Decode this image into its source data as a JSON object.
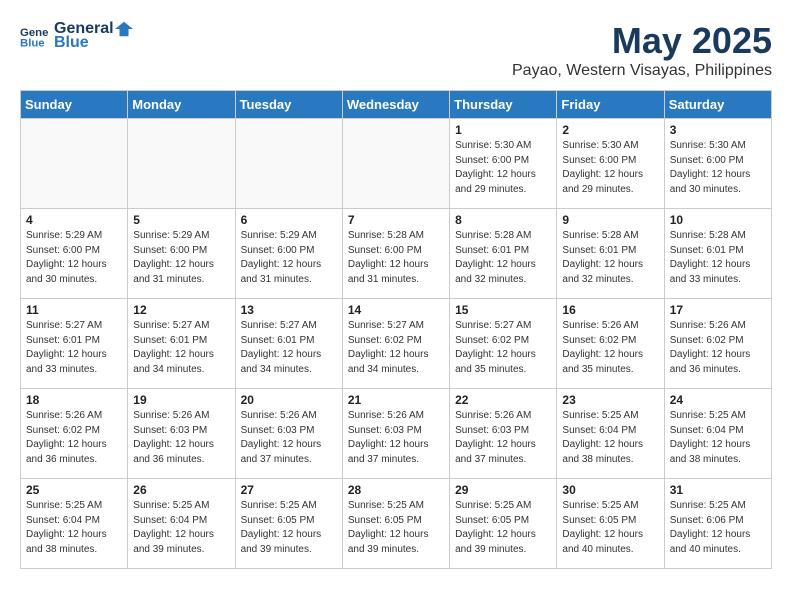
{
  "header": {
    "logo_line1": "General",
    "logo_line2": "Blue",
    "month_title": "May 2025",
    "location": "Payao, Western Visayas, Philippines"
  },
  "days_of_week": [
    "Sunday",
    "Monday",
    "Tuesday",
    "Wednesday",
    "Thursday",
    "Friday",
    "Saturday"
  ],
  "weeks": [
    [
      {
        "day": "",
        "info": ""
      },
      {
        "day": "",
        "info": ""
      },
      {
        "day": "",
        "info": ""
      },
      {
        "day": "",
        "info": ""
      },
      {
        "day": "1",
        "info": "Sunrise: 5:30 AM\nSunset: 6:00 PM\nDaylight: 12 hours\nand 29 minutes."
      },
      {
        "day": "2",
        "info": "Sunrise: 5:30 AM\nSunset: 6:00 PM\nDaylight: 12 hours\nand 29 minutes."
      },
      {
        "day": "3",
        "info": "Sunrise: 5:30 AM\nSunset: 6:00 PM\nDaylight: 12 hours\nand 30 minutes."
      }
    ],
    [
      {
        "day": "4",
        "info": "Sunrise: 5:29 AM\nSunset: 6:00 PM\nDaylight: 12 hours\nand 30 minutes."
      },
      {
        "day": "5",
        "info": "Sunrise: 5:29 AM\nSunset: 6:00 PM\nDaylight: 12 hours\nand 31 minutes."
      },
      {
        "day": "6",
        "info": "Sunrise: 5:29 AM\nSunset: 6:00 PM\nDaylight: 12 hours\nand 31 minutes."
      },
      {
        "day": "7",
        "info": "Sunrise: 5:28 AM\nSunset: 6:00 PM\nDaylight: 12 hours\nand 31 minutes."
      },
      {
        "day": "8",
        "info": "Sunrise: 5:28 AM\nSunset: 6:01 PM\nDaylight: 12 hours\nand 32 minutes."
      },
      {
        "day": "9",
        "info": "Sunrise: 5:28 AM\nSunset: 6:01 PM\nDaylight: 12 hours\nand 32 minutes."
      },
      {
        "day": "10",
        "info": "Sunrise: 5:28 AM\nSunset: 6:01 PM\nDaylight: 12 hours\nand 33 minutes."
      }
    ],
    [
      {
        "day": "11",
        "info": "Sunrise: 5:27 AM\nSunset: 6:01 PM\nDaylight: 12 hours\nand 33 minutes."
      },
      {
        "day": "12",
        "info": "Sunrise: 5:27 AM\nSunset: 6:01 PM\nDaylight: 12 hours\nand 34 minutes."
      },
      {
        "day": "13",
        "info": "Sunrise: 5:27 AM\nSunset: 6:01 PM\nDaylight: 12 hours\nand 34 minutes."
      },
      {
        "day": "14",
        "info": "Sunrise: 5:27 AM\nSunset: 6:02 PM\nDaylight: 12 hours\nand 34 minutes."
      },
      {
        "day": "15",
        "info": "Sunrise: 5:27 AM\nSunset: 6:02 PM\nDaylight: 12 hours\nand 35 minutes."
      },
      {
        "day": "16",
        "info": "Sunrise: 5:26 AM\nSunset: 6:02 PM\nDaylight: 12 hours\nand 35 minutes."
      },
      {
        "day": "17",
        "info": "Sunrise: 5:26 AM\nSunset: 6:02 PM\nDaylight: 12 hours\nand 36 minutes."
      }
    ],
    [
      {
        "day": "18",
        "info": "Sunrise: 5:26 AM\nSunset: 6:02 PM\nDaylight: 12 hours\nand 36 minutes."
      },
      {
        "day": "19",
        "info": "Sunrise: 5:26 AM\nSunset: 6:03 PM\nDaylight: 12 hours\nand 36 minutes."
      },
      {
        "day": "20",
        "info": "Sunrise: 5:26 AM\nSunset: 6:03 PM\nDaylight: 12 hours\nand 37 minutes."
      },
      {
        "day": "21",
        "info": "Sunrise: 5:26 AM\nSunset: 6:03 PM\nDaylight: 12 hours\nand 37 minutes."
      },
      {
        "day": "22",
        "info": "Sunrise: 5:26 AM\nSunset: 6:03 PM\nDaylight: 12 hours\nand 37 minutes."
      },
      {
        "day": "23",
        "info": "Sunrise: 5:25 AM\nSunset: 6:04 PM\nDaylight: 12 hours\nand 38 minutes."
      },
      {
        "day": "24",
        "info": "Sunrise: 5:25 AM\nSunset: 6:04 PM\nDaylight: 12 hours\nand 38 minutes."
      }
    ],
    [
      {
        "day": "25",
        "info": "Sunrise: 5:25 AM\nSunset: 6:04 PM\nDaylight: 12 hours\nand 38 minutes."
      },
      {
        "day": "26",
        "info": "Sunrise: 5:25 AM\nSunset: 6:04 PM\nDaylight: 12 hours\nand 39 minutes."
      },
      {
        "day": "27",
        "info": "Sunrise: 5:25 AM\nSunset: 6:05 PM\nDaylight: 12 hours\nand 39 minutes."
      },
      {
        "day": "28",
        "info": "Sunrise: 5:25 AM\nSunset: 6:05 PM\nDaylight: 12 hours\nand 39 minutes."
      },
      {
        "day": "29",
        "info": "Sunrise: 5:25 AM\nSunset: 6:05 PM\nDaylight: 12 hours\nand 39 minutes."
      },
      {
        "day": "30",
        "info": "Sunrise: 5:25 AM\nSunset: 6:05 PM\nDaylight: 12 hours\nand 40 minutes."
      },
      {
        "day": "31",
        "info": "Sunrise: 5:25 AM\nSunset: 6:06 PM\nDaylight: 12 hours\nand 40 minutes."
      }
    ]
  ]
}
